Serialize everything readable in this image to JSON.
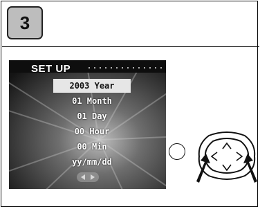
{
  "step": {
    "number": "3"
  },
  "setup_screen": {
    "title": "SET UP",
    "rows": [
      {
        "label": "2003 Year",
        "selected": true
      },
      {
        "label": "01 Month",
        "selected": false
      },
      {
        "label": "01 Day",
        "selected": false
      },
      {
        "label": "00 Hour",
        "selected": false
      },
      {
        "label": "00 Min",
        "selected": false
      },
      {
        "label": "yy/mm/dd",
        "selected": false
      }
    ],
    "nav_icons": [
      "left-arrow-icon",
      "right-arrow-icon"
    ]
  },
  "controls": {
    "round_button_icon": "circle-button-icon",
    "dpad_icon": "four-way-controller-icon",
    "pressed_directions": [
      "left",
      "right"
    ]
  }
}
